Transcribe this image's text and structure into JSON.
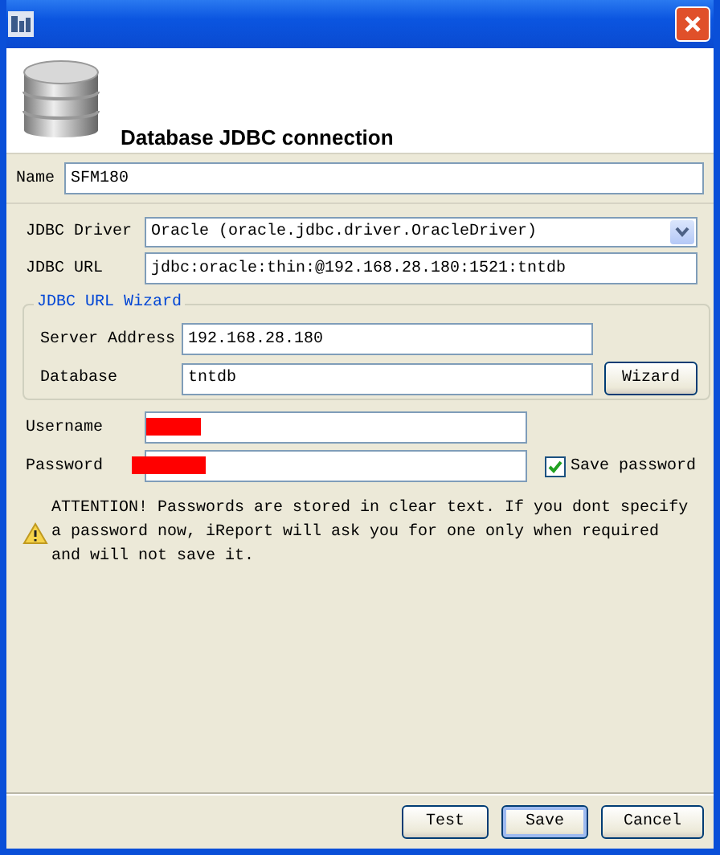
{
  "header": {
    "title": "Database JDBC connection"
  },
  "name_field": {
    "label": "Name",
    "value": "SFM180"
  },
  "driver": {
    "label": "JDBC Driver",
    "value": "Oracle (oracle.jdbc.driver.OracleDriver)"
  },
  "url": {
    "label": "JDBC URL",
    "value": "jdbc:oracle:thin:@192.168.28.180:1521:tntdb"
  },
  "wizard_group": {
    "legend": "JDBC URL Wizard",
    "fields": [
      {
        "label": "Server Address",
        "value": "192.168.28.180"
      },
      {
        "label": "Database",
        "value": "tntdb"
      }
    ],
    "button": "Wizard"
  },
  "credentials": [
    {
      "label": "Username",
      "redacted": true
    },
    {
      "label": "Password",
      "redacted": true
    }
  ],
  "save_password": {
    "label": "Save password",
    "checked": true
  },
  "warning": "ATTENTION! Passwords are stored in clear text. If you dont specify a password now, iReport will ask you for one only when required and will not save it.",
  "buttons": [
    {
      "label": "Test",
      "focused": false
    },
    {
      "label": "Save",
      "focused": true
    },
    {
      "label": "Cancel",
      "focused": false
    }
  ]
}
